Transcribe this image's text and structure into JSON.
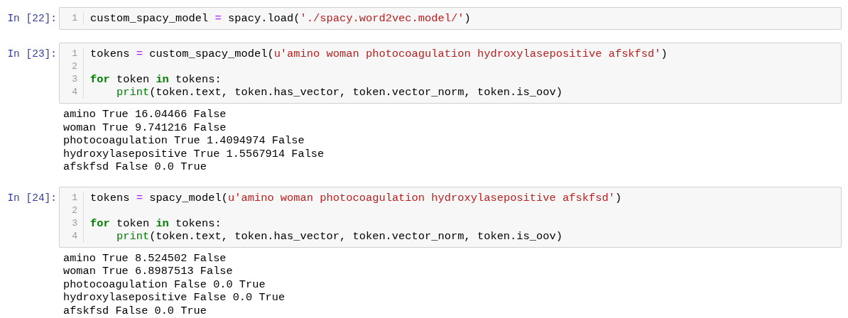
{
  "cells": [
    {
      "prompt": "In [22]:",
      "lines": [
        {
          "number": "1",
          "tokens": [
            {
              "kind": "plain",
              "text": "custom_spacy_model "
            },
            {
              "kind": "operator",
              "text": "="
            },
            {
              "kind": "plain",
              "text": " spacy.load("
            },
            {
              "kind": "string",
              "text": "'./spacy.word2vec.model/'"
            },
            {
              "kind": "plain",
              "text": ")"
            }
          ]
        }
      ]
    },
    {
      "prompt": "In [23]:",
      "lines": [
        {
          "number": "1",
          "tokens": [
            {
              "kind": "plain",
              "text": "tokens "
            },
            {
              "kind": "operator",
              "text": "="
            },
            {
              "kind": "plain",
              "text": " custom_spacy_model("
            },
            {
              "kind": "string",
              "text": "u'amino woman photocoagulation hydroxylasepositive afskfsd'"
            },
            {
              "kind": "plain",
              "text": ")"
            }
          ]
        },
        {
          "number": "2"
        },
        {
          "number": "3",
          "tokens": [
            {
              "kind": "keyword",
              "text": "for"
            },
            {
              "kind": "plain",
              "text": " token "
            },
            {
              "kind": "keyword",
              "text": "in"
            },
            {
              "kind": "plain",
              "text": " tokens:"
            }
          ]
        },
        {
          "number": "4",
          "tokens": [
            {
              "kind": "builtin",
              "text": "    print"
            },
            {
              "kind": "plain",
              "text": "(token.text, token.has_vector, token.vector_norm, token.is_oov)"
            }
          ]
        }
      ],
      "output": [
        "amino True 16.04466 False",
        "woman True 9.741216 False",
        "photocoagulation True 1.4094974 False",
        "hydroxylasepositive True 1.5567914 False",
        "afskfsd False 0.0 True"
      ]
    },
    {
      "prompt": "In [24]:",
      "lines": [
        {
          "number": "1",
          "tokens": [
            {
              "kind": "plain",
              "text": "tokens "
            },
            {
              "kind": "operator",
              "text": "="
            },
            {
              "kind": "plain",
              "text": " spacy_model("
            },
            {
              "kind": "string",
              "text": "u'amino woman photocoagulation hydroxylasepositive afskfsd'"
            },
            {
              "kind": "plain",
              "text": ")"
            }
          ]
        },
        {
          "number": "2"
        },
        {
          "number": "3",
          "tokens": [
            {
              "kind": "keyword",
              "text": "for"
            },
            {
              "kind": "plain",
              "text": " token "
            },
            {
              "kind": "keyword",
              "text": "in"
            },
            {
              "kind": "plain",
              "text": " tokens:"
            }
          ]
        },
        {
          "number": "4",
          "tokens": [
            {
              "kind": "builtin",
              "text": "    print"
            },
            {
              "kind": "plain",
              "text": "(token.text, token.has_vector, token.vector_norm, token.is_oov)"
            }
          ]
        }
      ],
      "output": [
        "amino True 8.524502 False",
        "woman True 6.8987513 False",
        "photocoagulation False 0.0 True",
        "hydroxylasepositive False 0.0 True",
        "afskfsd False 0.0 True"
      ]
    }
  ]
}
